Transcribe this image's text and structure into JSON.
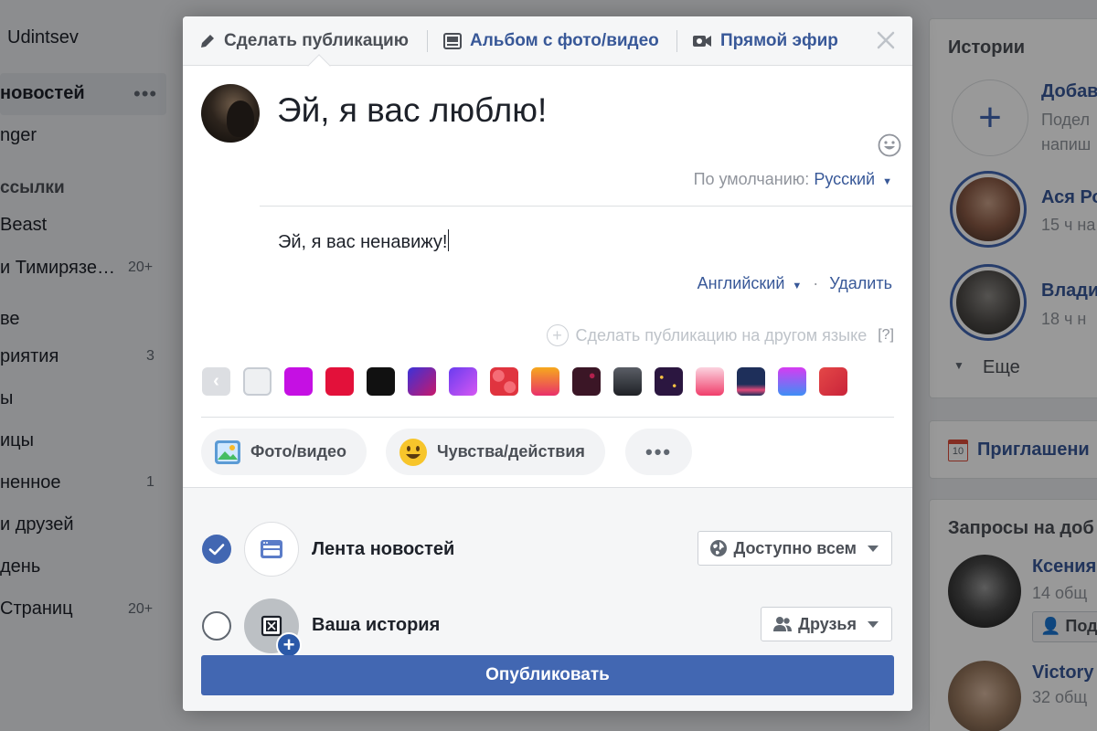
{
  "background": {
    "left_nav": {
      "user_name": "Udintsev",
      "active_item": "новостей",
      "more": "•••",
      "item_messenger": "nger",
      "section_lists": "ссылки",
      "item_beast": "Beast",
      "item_group": "и Тимирязе…",
      "item_group_count": "20+",
      "item_ve": "ве",
      "item_events": "риятия",
      "item_events_count": "3",
      "item_y": "ы",
      "item_pages": "ицы",
      "item_saved": "ненное",
      "item_saved_count": "1",
      "item_friends": "и друзей",
      "item_day": "день",
      "item_pages2": "Страниц",
      "item_pages2_count": "20+"
    },
    "right_col": {
      "stories_title": "Истории",
      "add_story_name": "Добав",
      "add_story_sub1": "Подел",
      "add_story_sub2": "напиш",
      "story1_name": "Ася Ро",
      "story1_time": "15 ч на",
      "story2_name": "Влади",
      "story2_time": "18 ч н",
      "more_label": "Еще",
      "invites_title": "Приглашени",
      "calendar_num": "10",
      "requests_title": "Запросы на доб",
      "req1_name": "Ксения",
      "req1_sub": "14 общ",
      "req1_btn": "Под",
      "req2_name": "Victory",
      "req2_sub": "32 общ"
    }
  },
  "composer": {
    "tabs": [
      {
        "label": "Сделать публикацию",
        "icon": "pencil-icon"
      },
      {
        "label": "Альбом с фото/видео",
        "icon": "album-icon"
      },
      {
        "label": "Прямой эфир",
        "icon": "video-camera-icon"
      }
    ],
    "main_text": "Эй, я вас люблю!",
    "default_lang_label": "По умолчанию:",
    "default_lang_value": "Русский",
    "second_text": "Эй, я вас ненавижу!",
    "second_lang": "Английский",
    "dot": "·",
    "delete_label": "Удалить",
    "other_lang_label": "Сделать публикацию на другом языке",
    "help_label": "[?]",
    "background_swatches": [
      {
        "name": "back",
        "color": "#dcdee2"
      },
      {
        "name": "plain",
        "color": "#eef0f2"
      },
      {
        "name": "magenta",
        "color": "#c510e3"
      },
      {
        "name": "red",
        "color": "#e3113a"
      },
      {
        "name": "black",
        "color": "#111111"
      },
      {
        "name": "purple-red-gradient",
        "color": "#5d2ee0"
      },
      {
        "name": "violet-gradient",
        "color": "#9a3ef0"
      },
      {
        "name": "hearts-pattern",
        "color": "#e0343f"
      },
      {
        "name": "orange-pink-gradient",
        "color": "#f5a623"
      },
      {
        "name": "dark-maroon-pattern",
        "color": "#3b1626"
      },
      {
        "name": "charcoal-gradient",
        "color": "#3a3d44"
      },
      {
        "name": "night-stars",
        "color": "#2b1640"
      },
      {
        "name": "pink-gradient",
        "color": "#f0466d"
      },
      {
        "name": "navy-skyline",
        "color": "#1e2f5a"
      },
      {
        "name": "blue-purple-gradient",
        "color": "#8a55f5"
      },
      {
        "name": "crimson",
        "color": "#d93536"
      }
    ],
    "actions": [
      {
        "label": "Фото/видео",
        "icon": "photo-icon"
      },
      {
        "label": "Чувства/действия",
        "icon": "smiley-icon"
      },
      {
        "label": "•••",
        "icon": "more-icon"
      }
    ],
    "destinations": [
      {
        "label": "Лента новостей",
        "checked": true,
        "audience": "Доступно всем",
        "audience_icon": "globe-icon"
      },
      {
        "label": "Ваша история",
        "checked": false,
        "audience": "Друзья",
        "audience_icon": "friends-icon"
      }
    ],
    "publish_label": "Опубликовать",
    "colors": {
      "accent": "#4267b2",
      "link": "#385898"
    }
  }
}
